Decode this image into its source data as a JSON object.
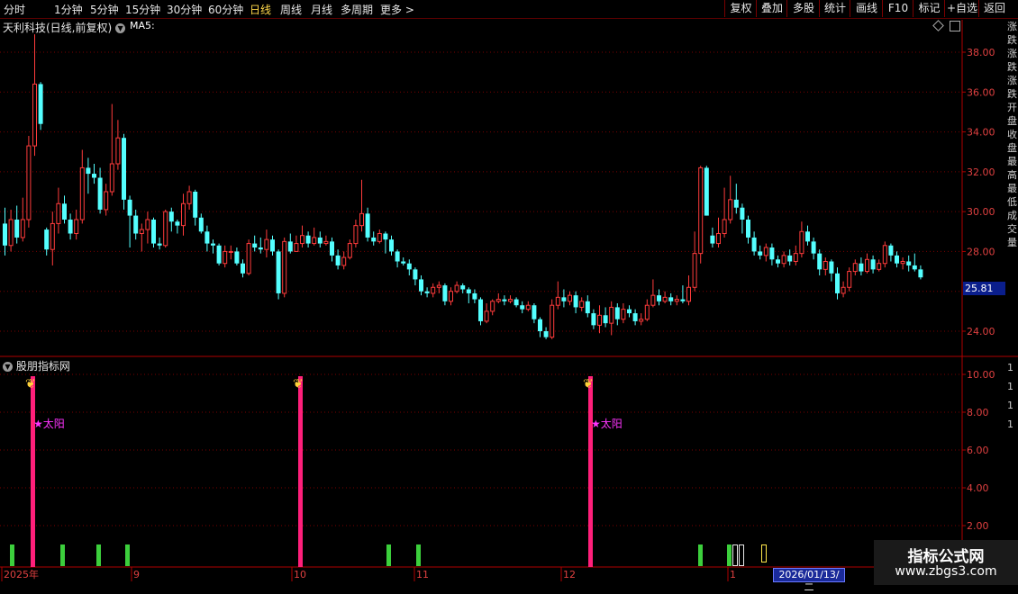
{
  "toolbar": {
    "periods": [
      "分时",
      "1分钟",
      "5分钟",
      "15分钟",
      "30分钟",
      "60分钟",
      "日线",
      "周线",
      "月线",
      "多周期",
      "更多 >"
    ],
    "active_period": "日线",
    "buttons": [
      "复权",
      "叠加",
      "多股",
      "统计",
      "画线",
      "F10",
      "标记",
      "+自选",
      "返回"
    ]
  },
  "main_chart": {
    "title": "天利科技(日线,前复权)",
    "ma_label": "MA5:",
    "current_price": "25.81",
    "y_ticks": [
      "38.00",
      "36.00",
      "34.00",
      "32.00",
      "30.00",
      "28.00",
      "24.00"
    ],
    "colors": {
      "up": "#ff3b3b",
      "down": "#54ffff",
      "grid": "#7a0000",
      "axis": "#b00000"
    }
  },
  "indicator": {
    "title": "股朋指标网",
    "y_ticks": [
      "10.00",
      "8.00",
      "6.00",
      "4.00",
      "2.00"
    ],
    "annotation": "★太阳",
    "colors": {
      "signal_bar": "#ff1f7a",
      "green_bar": "#3ccf3c",
      "annotation": "#ff33ff",
      "outline_bar": "#e8e8e8",
      "yellow_outline": "#ffe84a"
    }
  },
  "x_axis": {
    "labels": [
      "2025年",
      "9",
      "10",
      "11",
      "12",
      "1"
    ],
    "cursor_date": "2026/01/13/二"
  },
  "watermark": {
    "title": "指标公式网",
    "url": "www.zbgs3.com"
  },
  "right_strip": {
    "top_text": "涨跌涨跌涨跌开盘收盘最高最低成交量",
    "bottom_text": "1111"
  },
  "chart_data": {
    "type": "candlestick",
    "y_range": [
      23.0,
      39.0
    ],
    "candles": [
      [
        29.4,
        28.3,
        30.2,
        27.8
      ],
      [
        28.3,
        29.6,
        30.1,
        28.0
      ],
      [
        29.6,
        28.7,
        30.3,
        28.4
      ],
      [
        28.7,
        29.6,
        30.7,
        28.5
      ],
      [
        29.6,
        33.3,
        33.8,
        29.2
      ],
      [
        33.3,
        36.4,
        38.9,
        32.8
      ],
      [
        36.4,
        34.4,
        36.5,
        34.1
      ],
      [
        29.1,
        28.1,
        29.2,
        27.8
      ],
      [
        28.1,
        29.4,
        30.0,
        27.3
      ],
      [
        29.4,
        30.4,
        31.2,
        28.9
      ],
      [
        30.4,
        29.6,
        30.8,
        29.4
      ],
      [
        29.6,
        28.9,
        29.9,
        28.6
      ],
      [
        28.9,
        29.6,
        30.1,
        28.6
      ],
      [
        29.6,
        32.2,
        33.1,
        29.4
      ],
      [
        32.2,
        31.9,
        32.7,
        30.9
      ],
      [
        31.9,
        31.7,
        32.4,
        31.4
      ],
      [
        31.7,
        30.1,
        32.2,
        29.9
      ],
      [
        30.1,
        31.0,
        31.4,
        29.8
      ],
      [
        31.0,
        32.4,
        35.4,
        30.8
      ],
      [
        32.4,
        33.7,
        34.6,
        32.1
      ],
      [
        33.7,
        30.6,
        33.9,
        30.1
      ],
      [
        30.6,
        29.8,
        30.8,
        28.2
      ],
      [
        29.8,
        28.9,
        30.1,
        28.6
      ],
      [
        28.9,
        29.1,
        29.4,
        28.0
      ],
      [
        29.1,
        29.6,
        30.0,
        28.4
      ],
      [
        29.6,
        28.4,
        29.7,
        28.2
      ],
      [
        28.4,
        28.3,
        28.7,
        28.1
      ],
      [
        28.3,
        30.0,
        30.1,
        28.2
      ],
      [
        30.0,
        29.5,
        30.2,
        29.0
      ],
      [
        29.5,
        29.3,
        29.6,
        28.9
      ],
      [
        29.3,
        30.4,
        30.9,
        28.8
      ],
      [
        30.4,
        31.0,
        31.3,
        30.1
      ],
      [
        31.0,
        29.7,
        31.1,
        29.3
      ],
      [
        29.7,
        29.0,
        29.9,
        28.9
      ],
      [
        29.0,
        28.4,
        29.3,
        28.0
      ],
      [
        28.4,
        28.3,
        28.6,
        27.9
      ],
      [
        28.3,
        27.4,
        28.4,
        27.3
      ],
      [
        27.4,
        28.0,
        28.3,
        27.2
      ],
      [
        28.0,
        28.0,
        28.3,
        27.6
      ],
      [
        28.0,
        27.4,
        28.2,
        27.3
      ],
      [
        27.4,
        26.9,
        27.6,
        26.7
      ],
      [
        26.9,
        28.4,
        28.6,
        26.8
      ],
      [
        28.4,
        28.2,
        28.8,
        28.0
      ],
      [
        28.2,
        28.1,
        28.7,
        27.9
      ],
      [
        28.1,
        28.6,
        29.1,
        27.7
      ],
      [
        28.6,
        28.0,
        28.8,
        27.8
      ],
      [
        28.0,
        25.9,
        28.1,
        25.6
      ],
      [
        25.9,
        28.5,
        28.7,
        25.7
      ],
      [
        28.5,
        28.0,
        28.9,
        27.9
      ],
      [
        28.0,
        28.4,
        28.8,
        28.0
      ],
      [
        28.4,
        28.8,
        29.3,
        28.2
      ],
      [
        28.8,
        28.4,
        29.0,
        28.2
      ],
      [
        28.4,
        28.7,
        29.2,
        28.3
      ],
      [
        28.7,
        28.4,
        29.0,
        28.2
      ],
      [
        28.4,
        28.5,
        28.8,
        28.3
      ],
      [
        28.5,
        27.8,
        28.7,
        27.5
      ],
      [
        27.8,
        27.3,
        28.1,
        27.1
      ],
      [
        27.3,
        27.7,
        28.0,
        27.1
      ],
      [
        27.7,
        28.4,
        28.6,
        27.6
      ],
      [
        28.4,
        29.3,
        29.6,
        28.2
      ],
      [
        29.3,
        29.9,
        31.6,
        29.0
      ],
      [
        29.9,
        28.7,
        30.2,
        28.5
      ],
      [
        28.7,
        28.5,
        29.0,
        28.3
      ],
      [
        28.5,
        28.9,
        29.1,
        28.4
      ],
      [
        28.9,
        28.6,
        29.0,
        27.9
      ],
      [
        28.6,
        28.0,
        28.8,
        27.8
      ],
      [
        28.0,
        27.5,
        28.1,
        27.2
      ],
      [
        27.5,
        27.4,
        27.7,
        27.3
      ],
      [
        27.4,
        27.1,
        27.6,
        26.8
      ],
      [
        27.1,
        26.6,
        27.2,
        26.3
      ],
      [
        26.6,
        26.0,
        26.8,
        25.8
      ],
      [
        26.0,
        25.9,
        26.2,
        25.7
      ],
      [
        25.9,
        26.2,
        26.4,
        25.7
      ],
      [
        26.2,
        26.3,
        26.5,
        25.9
      ],
      [
        26.3,
        25.5,
        26.4,
        25.3
      ],
      [
        25.5,
        26.0,
        26.2,
        25.3
      ],
      [
        26.0,
        26.3,
        26.5,
        25.9
      ],
      [
        26.3,
        26.1,
        26.4,
        25.9
      ],
      [
        26.1,
        25.9,
        26.2,
        25.4
      ],
      [
        25.9,
        25.6,
        26.1,
        25.4
      ],
      [
        25.6,
        24.5,
        25.7,
        24.3
      ],
      [
        24.5,
        25.0,
        25.4,
        24.4
      ],
      [
        25.0,
        25.5,
        25.6,
        24.8
      ],
      [
        25.5,
        25.6,
        25.9,
        25.4
      ],
      [
        25.6,
        25.5,
        25.8,
        25.3
      ],
      [
        25.5,
        25.6,
        25.8,
        25.4
      ],
      [
        25.6,
        25.3,
        25.7,
        25.2
      ],
      [
        25.3,
        25.1,
        25.5,
        24.9
      ],
      [
        25.1,
        25.3,
        25.5,
        25.0
      ],
      [
        25.3,
        24.6,
        25.4,
        24.4
      ],
      [
        24.6,
        24.0,
        24.7,
        23.7
      ],
      [
        24.0,
        23.7,
        24.2,
        23.6
      ],
      [
        23.7,
        25.3,
        25.6,
        23.6
      ],
      [
        25.3,
        25.7,
        26.5,
        25.1
      ],
      [
        25.7,
        25.5,
        26.1,
        25.2
      ],
      [
        25.5,
        25.8,
        26.0,
        25.3
      ],
      [
        25.8,
        25.2,
        26.0,
        24.9
      ],
      [
        25.2,
        25.5,
        25.7,
        25.0
      ],
      [
        25.5,
        24.9,
        25.8,
        24.7
      ],
      [
        24.9,
        24.3,
        25.1,
        24.1
      ],
      [
        24.3,
        24.8,
        25.3,
        23.9
      ],
      [
        24.8,
        24.4,
        25.2,
        24.2
      ],
      [
        24.4,
        25.2,
        25.5,
        23.8
      ],
      [
        25.2,
        24.6,
        25.4,
        24.3
      ],
      [
        24.6,
        25.1,
        25.4,
        24.4
      ],
      [
        25.1,
        24.9,
        25.3,
        24.7
      ],
      [
        24.9,
        24.5,
        25.1,
        24.3
      ],
      [
        24.5,
        24.6,
        24.9,
        24.3
      ],
      [
        24.6,
        25.3,
        25.6,
        24.5
      ],
      [
        25.3,
        25.8,
        26.6,
        25.2
      ],
      [
        25.8,
        25.5,
        26.1,
        25.3
      ],
      [
        25.5,
        25.7,
        26.0,
        25.4
      ],
      [
        25.7,
        25.5,
        25.9,
        25.3
      ],
      [
        25.5,
        25.6,
        25.8,
        25.3
      ],
      [
        25.6,
        25.5,
        26.3,
        25.4
      ],
      [
        25.5,
        26.2,
        26.8,
        25.3
      ],
      [
        26.2,
        27.9,
        29.0,
        26.0
      ],
      [
        27.9,
        32.2,
        32.3,
        27.4
      ],
      [
        32.2,
        29.8,
        32.3,
        29.8
      ],
      [
        28.8,
        28.4,
        29.2,
        28.2
      ],
      [
        28.4,
        28.9,
        29.7,
        28.2
      ],
      [
        28.9,
        29.6,
        31.2,
        28.7
      ],
      [
        29.6,
        30.6,
        31.8,
        29.4
      ],
      [
        30.6,
        30.2,
        31.4,
        29.9
      ],
      [
        30.2,
        29.6,
        30.4,
        28.9
      ],
      [
        29.6,
        28.7,
        29.8,
        28.4
      ],
      [
        28.7,
        28.0,
        29.0,
        27.8
      ],
      [
        28.0,
        27.8,
        28.3,
        27.6
      ],
      [
        27.8,
        28.2,
        28.4,
        27.5
      ],
      [
        28.2,
        27.6,
        28.4,
        27.3
      ],
      [
        27.6,
        27.4,
        27.8,
        27.2
      ],
      [
        27.4,
        27.8,
        28.0,
        27.2
      ],
      [
        27.8,
        27.5,
        28.1,
        27.3
      ],
      [
        27.5,
        27.9,
        28.3,
        27.3
      ],
      [
        27.9,
        29.0,
        29.5,
        27.7
      ],
      [
        29.0,
        28.5,
        29.3,
        28.3
      ],
      [
        28.5,
        27.9,
        28.7,
        27.6
      ],
      [
        27.9,
        27.1,
        28.1,
        26.8
      ],
      [
        27.1,
        27.5,
        27.7,
        26.8
      ],
      [
        27.5,
        26.9,
        27.6,
        26.5
      ],
      [
        26.9,
        25.9,
        27.2,
        25.6
      ],
      [
        25.9,
        26.2,
        26.5,
        25.7
      ],
      [
        26.2,
        27.0,
        27.2,
        26.0
      ],
      [
        27.0,
        27.4,
        27.6,
        26.8
      ],
      [
        27.4,
        27.0,
        27.7,
        26.8
      ],
      [
        27.0,
        27.6,
        27.9,
        26.9
      ],
      [
        27.6,
        27.1,
        27.8,
        26.9
      ],
      [
        27.1,
        27.4,
        27.6,
        27.0
      ],
      [
        27.4,
        28.3,
        28.5,
        27.2
      ],
      [
        28.3,
        27.8,
        28.4,
        27.5
      ],
      [
        27.8,
        27.4,
        28.0,
        27.2
      ],
      [
        27.4,
        27.5,
        27.7,
        27.1
      ],
      [
        27.5,
        27.3,
        27.8,
        27.0
      ],
      [
        27.3,
        27.1,
        27.9,
        27.0
      ],
      [
        27.1,
        26.7,
        27.3,
        26.6
      ]
    ]
  }
}
